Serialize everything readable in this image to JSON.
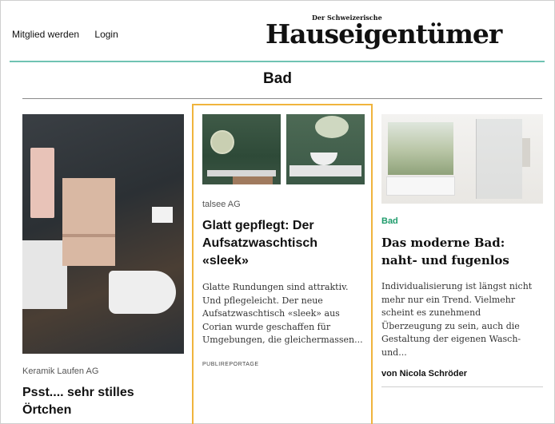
{
  "header": {
    "nav": [
      "Mitglied werden",
      "Login"
    ],
    "logo_pre": "Der Schweizerische",
    "logo_main": "Hauseigentümer",
    "accent_color": "#6fc3b3"
  },
  "section": {
    "title": "Bad"
  },
  "cards": [
    {
      "company": "Keramik Laufen AG",
      "title": "Psst.... sehr stilles Örtchen"
    },
    {
      "company": "talsee AG",
      "title": "Glatt gepflegt: Der Aufsatzwaschtisch «sleek»",
      "teaser": "Glatte Rundungen sind attraktiv. Und pflegeleicht. Der neue Aufsatzwaschtisch «sleek» aus Corian wurde geschaffen für Umgebungen, die gleichermassen...",
      "tag": "PUBLIREPORTAGE",
      "highlight_color": "#f0b43c"
    },
    {
      "category": "Bad",
      "title": "Das moderne Bad: naht- und fugenlos",
      "teaser": "Individualisierung ist längst nicht mehr nur ein Trend. Vielmehr scheint es zunehmend Überzeugung zu sein, auch die Gestaltung der eigenen Wasch- und...",
      "author": "von Nicola Schröder",
      "category_color": "#1e9b6b"
    }
  ]
}
